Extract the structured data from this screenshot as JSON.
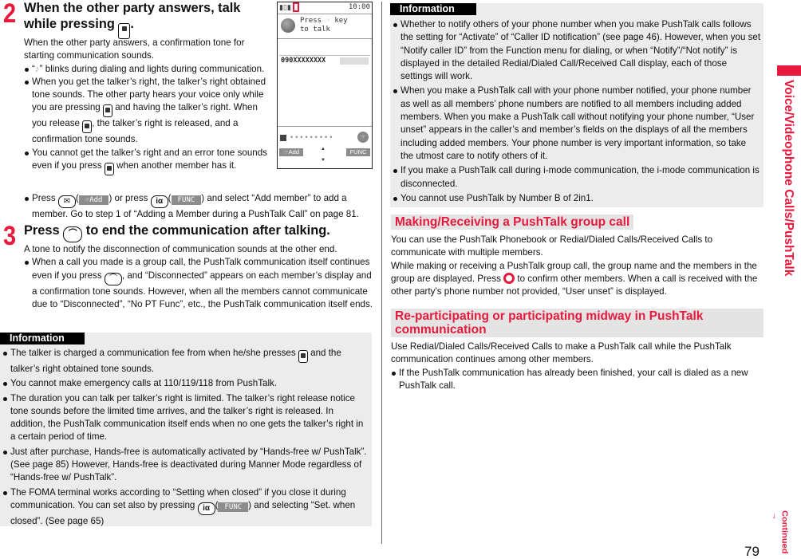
{
  "page_number": "79",
  "side_tab": {
    "label": "Voice/Videophone Calls/PushTalk",
    "accent": "#e8193c"
  },
  "continued": {
    "label": "Continued",
    "arrow": "→"
  },
  "colors": {
    "accent": "#e8193c",
    "info_bg": "#ececec",
    "softkey_bg": "#8c8c8c"
  },
  "step2": {
    "number": "2",
    "heading_line1": "When the other party answers, talk",
    "heading_line2_pre": "while pressing",
    "heading_line2_post": ".",
    "intro": "When the other party answers, a confirmation tone for starting communication sounds.",
    "bullets": {
      "b1_pre": "“",
      "b1_post": "” blinks during dialing and lights during communication.",
      "b2_a": "When you get the talker’s right, the talker’s right obtained tone sounds. The other party hears your voice only while you are pressing",
      "b2_b": "and having the talker’s right. When you release",
      "b2_c": ", the talker’s right is released, and a confirmation tone sounds.",
      "b3_a": "You cannot get the talker’s right and an error tone sounds even if you press",
      "b3_b": "when another member has it.",
      "b4_a": "Press",
      "b4_b": "or press",
      "b4_c": "and select “Add member” to add a member. Go to step 1 of “Adding a Member during a PushTalk Call” on page 81."
    }
  },
  "step3": {
    "number": "3",
    "heading_pre": "Press",
    "heading_post": "to end the communication after talking.",
    "intro": "A tone to notify the disconnection of communication sounds at the other end.",
    "b1_a": "When a call you made is a group call, the PushTalk communication itself continues even if you press",
    "b1_b": ", and “Disconnected” appears on each member’s display and a confirmation tone sounds. However, when all the members cannot communicate due to “Disconnected”, “No PT Func”, etc., the PushTalk communication itself ends."
  },
  "keys": {
    "mail": "✉",
    "imode": "iα",
    "end": "⌒",
    "add_soft": "☞Add",
    "func_soft": "FUNC"
  },
  "phone_screen": {
    "time": "10:00",
    "prompt_line1": "Press",
    "prompt_key": "☞",
    "prompt_line1_end": "key",
    "prompt_line2": "to talk",
    "number": "090XXXXXXXX",
    "soft_left": "☞Add",
    "soft_right": "FUNC",
    "nav_up": "▲",
    "nav_down": "▼"
  },
  "info_left": {
    "label": "Information",
    "items": [
      {
        "a": "The talker is charged a communication fee from when he/she presses",
        "b": "and the talker’s right obtained tone sounds."
      },
      {
        "a": "You cannot make emergency calls at 110/119/118 from PushTalk."
      },
      {
        "a": "The duration you can talk per talker’s right is limited. The talker’s right release notice tone sounds before the limited time arrives, and the talker’s right is released. In addition, the PushTalk communication itself ends when no one gets the talker’s right in a certain period of time."
      },
      {
        "a": "Just after purchase, Hands-free is automatically activated by “Hands-free w/ PushTalk”. (See page 85) However, Hands-free is deactivated during Manner Mode regardless of “Hands-free w/ PushTalk”."
      },
      {
        "a": "The FOMA terminal works according to “Setting when closed” if you close it during communication. You can set also by pressing",
        "b": "and selecting “Set. when closed”. (See page 65)"
      }
    ]
  },
  "info_right": {
    "label": "Information",
    "items": [
      "Whether to notify others of your phone number when you make PushTalk calls follows the setting for “Activate” of “Caller ID notification” (see page 46). However, when you set “Notify caller ID” from the Function menu for dialing, or when “Notify”/“Not notify” is displayed in the detailed Redial/Dialed Call/Received Call display, each of those settings will work.",
      "When you make a PushTalk call with your phone number notified, your phone number as well as all members’ phone numbers are notified to all members including added members. When you make a PushTalk call without notifying your phone number, “User unset” appears in the caller’s and member’s fields on the displays of all the members including added members. Your phone number is very important information, so take the utmost care to notify others of it.",
      "If you make a PushTalk call during i-mode communication, the i-mode communication is disconnected.",
      "You cannot use PushTalk by Number B of 2in1."
    ]
  },
  "section_group": {
    "heading": "Making/Receiving a PushTalk group call",
    "p1": "You can use the PushTalk Phonebook or Redial/Dialed Calls/Received Calls to communicate with multiple members.",
    "p2_a": "While making or receiving a PushTalk group call, the group name and the members in the group are displayed. Press",
    "p2_b": "to confirm other members. When a call is received with the other party’s phone number not provided, “User unset” is displayed."
  },
  "section_rejoin": {
    "heading_line1": "Re-participating or participating midway in PushTalk",
    "heading_line2": "communication",
    "p1": "Use Redial/Dialed Calls/Received Calls to make a PushTalk call while the PushTalk communication continues among other members.",
    "b1": "If the PushTalk communication has already been finished, your call is dialed as a new PushTalk call."
  }
}
